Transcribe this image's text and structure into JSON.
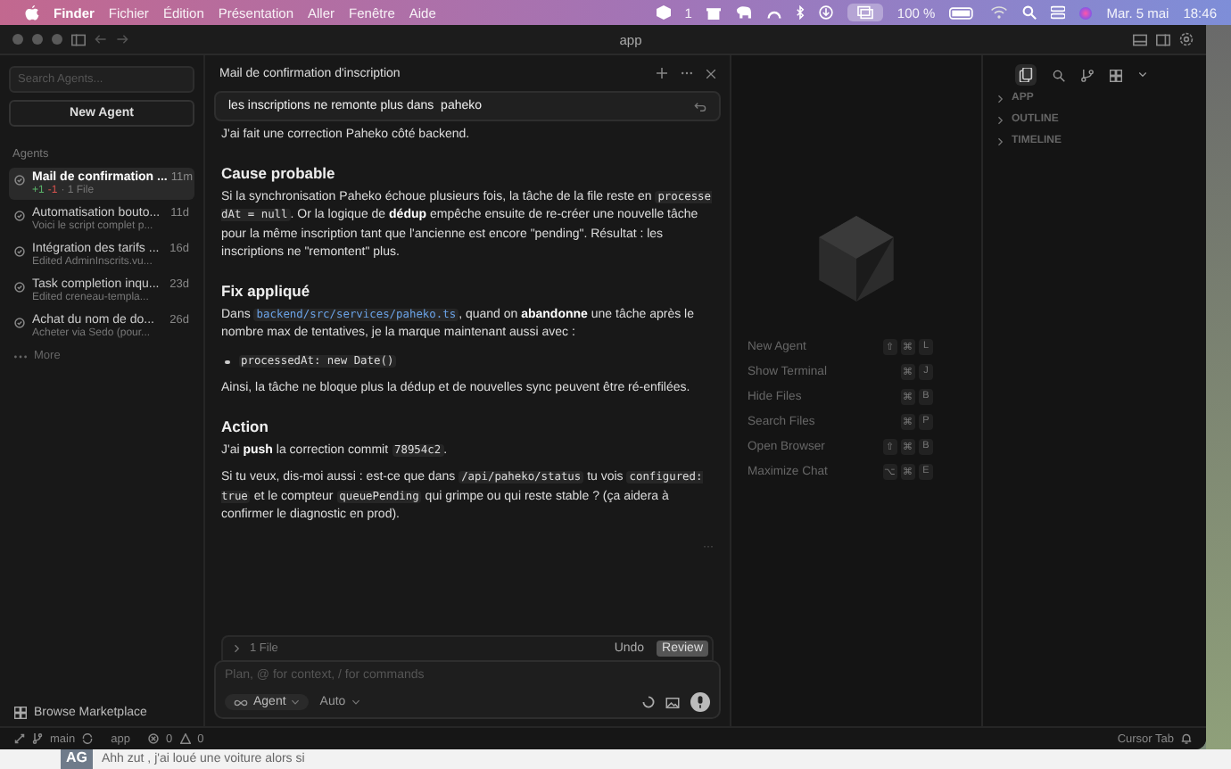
{
  "menu_bar": {
    "app": "Finder",
    "items": [
      "Fichier",
      "Édition",
      "Présentation",
      "Aller",
      "Fenêtre",
      "Aide"
    ],
    "badge_count": "1",
    "battery": "100 %",
    "date": "Mar. 5 mai",
    "time": "18:46"
  },
  "window": {
    "title": "app"
  },
  "sidebar": {
    "search": {
      "placeholder": "Search Agents..."
    },
    "new_button": "New Agent",
    "section": "Agents",
    "agents": [
      {
        "title": "Mail de confirmation ...",
        "time": "11m",
        "subtitle": "· 1 File",
        "added": "+1",
        "removed": "-1",
        "selected": true
      },
      {
        "title": "Automatisation bouto...",
        "time": "11d",
        "subtitle": "Voici le script complet p...",
        "selected": false
      },
      {
        "title": "Intégration des tarifs ...",
        "time": "16d",
        "subtitle": "Edited AdminInscrits.vu...",
        "selected": false
      },
      {
        "title": "Task completion inqu...",
        "time": "23d",
        "subtitle": "Edited creneau-templa...",
        "selected": false
      },
      {
        "title": "Achat du nom de do...",
        "time": "26d",
        "subtitle": "Acheter via Sedo (pour...",
        "selected": false
      }
    ],
    "more": "More",
    "marketplace": "Browse Marketplace"
  },
  "chat": {
    "title": "Mail de confirmation d'inscription",
    "query": "les inscriptions ne remonte plus dans  paheko",
    "blocks": [
      {
        "kind": "paragraph",
        "segments": [
          {
            "kind": "text",
            "text": "J'ai fait une correction Paheko côté backend."
          }
        ]
      },
      {
        "kind": "heading",
        "text": "Cause probable"
      },
      {
        "kind": "paragraph",
        "segments": [
          {
            "kind": "text",
            "text": "Si la synchronisation Paheko échoue plusieurs fois, la tâche de la file reste en "
          },
          {
            "kind": "code",
            "text": "processedAt = null"
          },
          {
            "kind": "text",
            "text": ". Or la logique de **dédup** empêche ensuite de re-créer une nouvelle tâche pour la même inscription tant que l'ancienne est encore \"pending\". Résultat : les inscriptions ne \"remontent\" plus."
          }
        ]
      },
      {
        "kind": "heading",
        "text": "Fix appliqué"
      },
      {
        "kind": "paragraph",
        "segments": [
          {
            "kind": "text",
            "text": "Dans "
          },
          {
            "kind": "path",
            "text": "backend/src/services/paheko.ts"
          },
          {
            "kind": "text",
            "text": ", quand on **abandonne** une tâche après le nombre max de tentatives, je la marque maintenant aussi avec :"
          }
        ]
      },
      {
        "kind": "bullet",
        "segments": [
          {
            "kind": "code",
            "text": "processedAt: new Date()"
          }
        ]
      },
      {
        "kind": "paragraph",
        "segments": [
          {
            "kind": "text",
            "text": "Ainsi, la tâche ne bloque plus la dédup et de nouvelles sync peuvent être ré-enfilées."
          }
        ]
      },
      {
        "kind": "heading",
        "text": "Action"
      },
      {
        "kind": "paragraph",
        "segments": [
          {
            "kind": "text",
            "text": "J'ai **push** la correction commit "
          },
          {
            "kind": "code",
            "text": "78954c2"
          },
          {
            "kind": "text",
            "text": "."
          }
        ]
      },
      {
        "kind": "paragraph",
        "segments": [
          {
            "kind": "text",
            "text": "Si tu veux, dis-moi aussi : est-ce que dans "
          },
          {
            "kind": "code",
            "text": "/api/paheko/status"
          },
          {
            "kind": "text",
            "text": " tu vois "
          },
          {
            "kind": "code",
            "text": "configured: true"
          },
          {
            "kind": "text",
            "text": " et le compteur "
          },
          {
            "kind": "code",
            "text": "queuePending"
          },
          {
            "kind": "text",
            "text": " qui grimpe ou qui reste stable ? (ça aidera à confirmer le diagnostic en prod)."
          }
        ]
      }
    ],
    "more": "···",
    "changes": {
      "label": "1 File",
      "undo": "Undo",
      "review": "Review"
    },
    "composer": {
      "placeholder": "Plan, @ for context, / for commands",
      "mode": "Agent",
      "model": "Auto"
    }
  },
  "shortcuts": [
    {
      "label": "New Agent",
      "keys": [
        "⇧",
        "⌘",
        "L"
      ]
    },
    {
      "label": "Show Terminal",
      "keys": [
        "⌘",
        "J"
      ]
    },
    {
      "label": "Hide Files",
      "keys": [
        "⌘",
        "B"
      ]
    },
    {
      "label": "Search Files",
      "keys": [
        "⌘",
        "P"
      ]
    },
    {
      "label": "Open Browser",
      "keys": [
        "⇧",
        "⌘",
        "B"
      ]
    },
    {
      "label": "Maximize Chat",
      "keys": [
        "⌥",
        "⌘",
        "E"
      ]
    }
  ],
  "explorer": {
    "sections": [
      {
        "label": "APP",
        "expanded": false
      },
      {
        "label": "OUTLINE",
        "expanded": false
      },
      {
        "label": "TIMELINE",
        "expanded": false
      }
    ]
  },
  "status_bar": {
    "branch": "main",
    "folder": "app",
    "errors": "0",
    "warnings": "0",
    "right": "Cursor Tab"
  },
  "background": {
    "avatar": "AG",
    "message": "Ahh zut , j'ai loué une voiture alors si"
  }
}
